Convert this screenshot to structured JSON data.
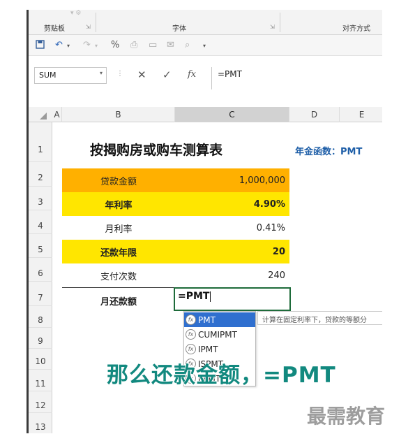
{
  "ribbon": {
    "clipboard_label": "剪贴板",
    "font_label": "字体",
    "alignment_label": "对齐方式"
  },
  "qat": {
    "icons": [
      "save-icon",
      "undo-icon",
      "redo-icon",
      "percent-icon",
      "print-icon",
      "new-icon",
      "preview-icon",
      "customize-icon"
    ]
  },
  "formula_bar": {
    "name_box": "SUM",
    "cancel": "✕",
    "enter": "✓",
    "fx": "fx",
    "content": "=PMT"
  },
  "columns": [
    "A",
    "B",
    "C",
    "D",
    "E"
  ],
  "rows": [
    "1",
    "2",
    "3",
    "4",
    "5",
    "6",
    "7",
    "8",
    "9",
    "10",
    "11",
    "12",
    "13"
  ],
  "sheet": {
    "title": "按揭购房或购车测算表",
    "func_note": "年金函数：PMT",
    "loan_label": "贷款金额",
    "loan_value": "1,000,000",
    "rate_label": "年利率",
    "rate_value": "4.90%",
    "month_rate_label": "月利率",
    "month_rate_value": "0.41%",
    "years_label": "还款年限",
    "years_value": "20",
    "payments_label": "支付次数",
    "payments_value": "240",
    "monthly_label": "月还款额",
    "monthly_input": "=PMT"
  },
  "autocomplete": {
    "items": [
      "PMT",
      "CUMIPMT",
      "IPMT",
      "ISPMT",
      "PPMT"
    ],
    "selected_index": 0,
    "tooltip": "计算在固定利率下，贷款的等额分"
  },
  "overlay": {
    "subtitle": "那么还款金额，=PMT",
    "watermark": "最需教育"
  },
  "colors": {
    "orange": "#ffb000",
    "yellow": "#ffe600",
    "accent_blue": "#1f5fa8",
    "subtitle_teal": "#12897f",
    "selection_blue": "#2f6fcf"
  }
}
